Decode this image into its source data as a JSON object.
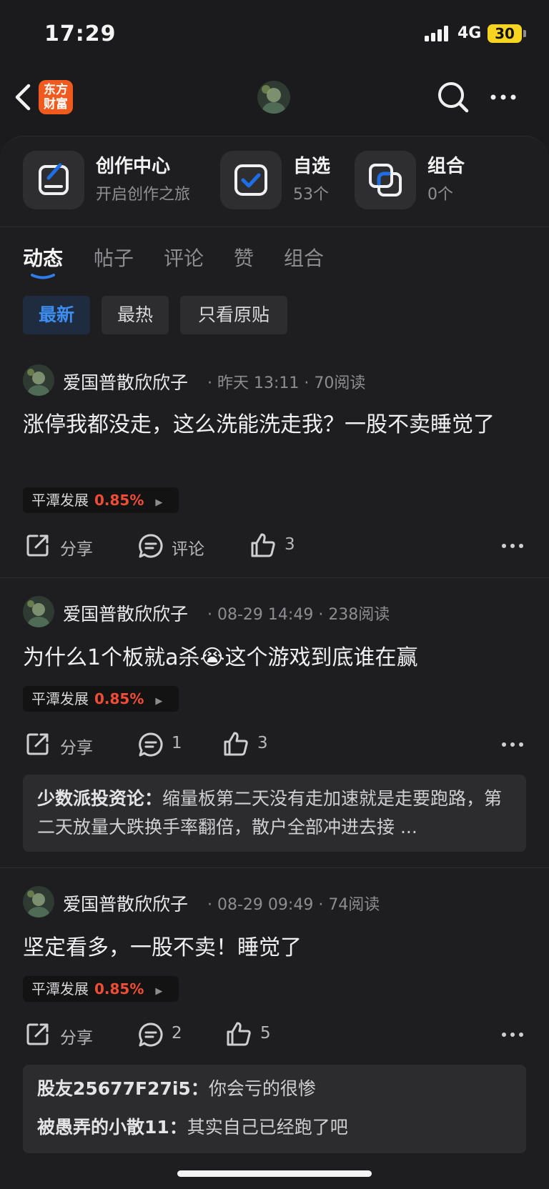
{
  "status_bar": {
    "time": "17:29",
    "network": "4G",
    "battery": "30"
  },
  "header": {
    "logo_line1": "东方",
    "logo_line2": "财富"
  },
  "quick_actions": [
    {
      "title": "创作中心",
      "subtitle": "开启创作之旅",
      "icon": "edit-icon"
    },
    {
      "title": "自选",
      "subtitle": "53个",
      "icon": "checkbox-icon"
    },
    {
      "title": "组合",
      "subtitle": "0个",
      "icon": "portfolio-icon"
    }
  ],
  "tabs": [
    "动态",
    "帖子",
    "评论",
    "赞",
    "组合"
  ],
  "active_tab": "动态",
  "filters": [
    "最新",
    "最热",
    "只看原贴"
  ],
  "active_filter": "最新",
  "colors": {
    "accent": "#3d8cf0",
    "rise": "#f14d36",
    "background": "#1b1b1d"
  },
  "posts": [
    {
      "author": "爱国普散欣欣子",
      "time": "昨天 13:11",
      "reads": "70阅读",
      "text": "涨停我都没走，这么洗能洗走我？一股不卖睡觉了",
      "stock": {
        "name": "平潭发展",
        "change": "0.85%"
      },
      "share": "分享",
      "comment": "评论",
      "likes": "3"
    },
    {
      "author": "爱国普散欣欣子",
      "time": "08-29 14:49",
      "reads": "238阅读",
      "text": "为什么1个板就a杀😭这个游戏到底谁在赢",
      "stock": {
        "name": "平潭发展",
        "change": "0.85%"
      },
      "share": "分享",
      "comment": "1",
      "likes": "3",
      "replies": [
        {
          "user": "少数派投资论：",
          "text": "缩量板第二天没有走加速就是走要跑路，第二天放量大跌换手率翻倍，散户全部冲进去接 ..."
        }
      ]
    },
    {
      "author": "爱国普散欣欣子",
      "time": "08-29 09:49",
      "reads": "74阅读",
      "text": "坚定看多，一股不卖！睡觉了",
      "stock": {
        "name": "平潭发展",
        "change": "0.85%"
      },
      "share": "分享",
      "comment": "2",
      "likes": "5",
      "replies": [
        {
          "user": "股友25677F27i5：",
          "text": "你会亏的很惨"
        },
        {
          "user": "被愚弄的小散11：",
          "text": "其实自己已经跑了吧"
        }
      ]
    }
  ]
}
